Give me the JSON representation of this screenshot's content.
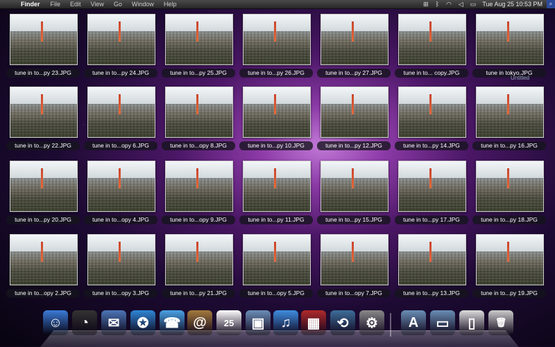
{
  "menubar": {
    "apple": "",
    "app": "Finder",
    "menus": [
      "File",
      "Edit",
      "View",
      "Go",
      "Window",
      "Help"
    ],
    "clock": "Tue Aug 25  10:53 PM"
  },
  "desktop": {
    "files": [
      "tune in to...py 23.JPG",
      "tune in to...py 24.JPG",
      "tune in to...py 25.JPG",
      "tune in to...py 26.JPG",
      "tune in to...py 27.JPG",
      "tune in to... copy.JPG",
      "tune in tokyo.JPG",
      "tune in to...py 22.JPG",
      "tune in to...opy 6.JPG",
      "tune in to...opy 8.JPG",
      "tune in to...py 10.JPG",
      "tune in to...py 12.JPG",
      "tune in to...py 14.JPG",
      "tune in to...py 16.JPG",
      "tune in to...py 20.JPG",
      "tune in to...opy 4.JPG",
      "tune in to...opy 9.JPG",
      "tune in to...py 11.JPG",
      "tune in to...py 15.JPG",
      "tune in to...py 17.JPG",
      "tune in to...py 18.JPG",
      "tune in to...opy 2.JPG",
      "tune in to...opy 3.JPG",
      "tune in to...py 21.JPG",
      "tune in to...opy 5.JPG",
      "tune in to...opy 7.JPG",
      "tune in to...py 13.JPG",
      "tune in to...py 19.JPG"
    ],
    "untitled_label": "Untitled"
  },
  "dock": {
    "items": [
      {
        "name": "finder-icon",
        "glyph": "☺",
        "color": "#3b7bd8"
      },
      {
        "name": "dashboard-icon",
        "glyph": "◔",
        "color": "#333"
      },
      {
        "name": "mail-icon",
        "glyph": "✉",
        "color": "#4d76b8"
      },
      {
        "name": "safari-icon",
        "glyph": "✪",
        "color": "#2e86d6"
      },
      {
        "name": "ichat-icon",
        "glyph": "☎",
        "color": "#4aa3e6"
      },
      {
        "name": "address-book-icon",
        "glyph": "@",
        "color": "#a57a3d"
      },
      {
        "name": "ical-icon",
        "glyph": "25",
        "color": "#ffffff"
      },
      {
        "name": "iphoto-icon",
        "glyph": "▣",
        "color": "#6b8fb8"
      },
      {
        "name": "itunes-icon",
        "glyph": "♫",
        "color": "#3e8ee0"
      },
      {
        "name": "photo-booth-icon",
        "glyph": "▦",
        "color": "#b02a2a"
      },
      {
        "name": "time-machine-icon",
        "glyph": "⟲",
        "color": "#3d6e9a"
      },
      {
        "name": "system-preferences-icon",
        "glyph": "⚙",
        "color": "#8a8a8a"
      },
      {
        "name": "applications-folder-icon",
        "glyph": "A",
        "color": "#6a8fb5"
      },
      {
        "name": "documents-folder-icon",
        "glyph": "▭",
        "color": "#6a8fb5"
      },
      {
        "name": "downloads-stack-icon",
        "glyph": "▯",
        "color": "#dddddd"
      },
      {
        "name": "trash-icon",
        "glyph": "🗑",
        "color": "#cccccc"
      }
    ]
  }
}
